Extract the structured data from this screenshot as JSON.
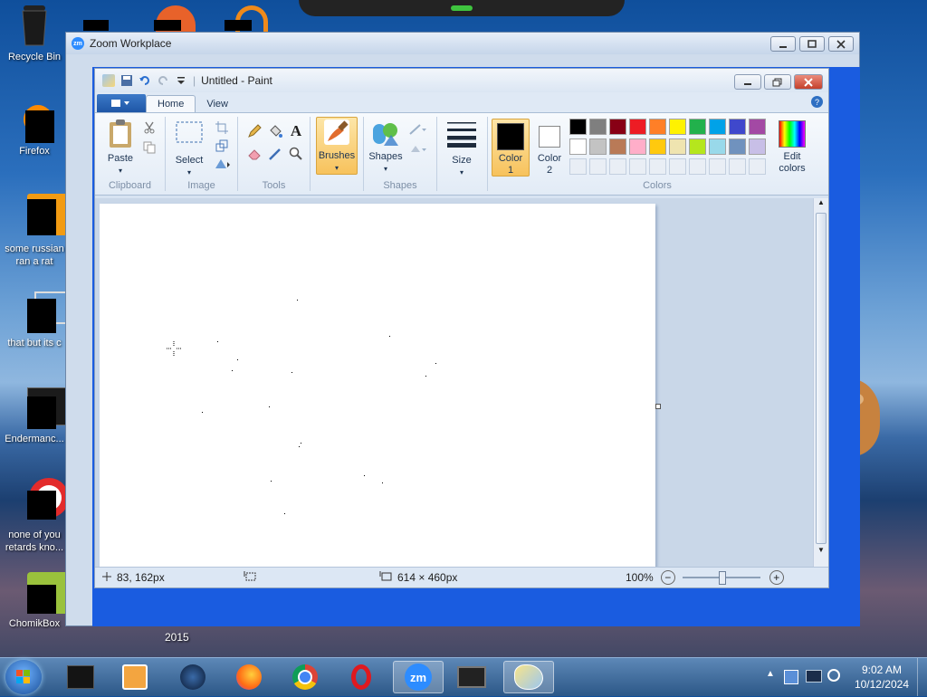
{
  "desktop": {
    "icons": [
      {
        "label": "Recycle Bin"
      },
      {
        "label": "Firefox"
      },
      {
        "label": "some russian ran a rat"
      },
      {
        "label": "that but its c"
      },
      {
        "label": "Endermanc..."
      },
      {
        "label": "none of you retards kno..."
      },
      {
        "label": "ChomikBox"
      }
    ],
    "stray_text": "2015"
  },
  "zoom": {
    "title": "Zoom Workplace",
    "logo": "zm"
  },
  "paint": {
    "title": "Untitled - Paint",
    "tabs": [
      "Home",
      "View"
    ],
    "ribbon": {
      "paste": "Paste",
      "select": "Select",
      "brushes": "Brushes",
      "shapes": "Shapes",
      "size": "Size",
      "color1": "Color 1",
      "color2": "Color 2",
      "edit_colors": "Edit colors",
      "groups": [
        "Clipboard",
        "Image",
        "Tools",
        "Shapes",
        "Colors"
      ]
    },
    "palette_row1": [
      "#000000",
      "#7f7f7f",
      "#880015",
      "#ed1c24",
      "#ff7f27",
      "#fff200",
      "#22b14c",
      "#00a2e8",
      "#3f48cc",
      "#a349a4"
    ],
    "palette_row2": [
      "#ffffff",
      "#c3c3c3",
      "#b97a57",
      "#ffaec9",
      "#ffc90e",
      "#efe4b0",
      "#b5e61d",
      "#99d9ea",
      "#7092be",
      "#c8bfe7"
    ],
    "color1_value": "#000000",
    "color2_value": "#ffffff",
    "status": {
      "cursor": "83, 162px",
      "size": "614 × 460px",
      "zoom": "100%"
    }
  },
  "taskbar": {
    "time": "9:02 AM",
    "date": "10/12/2024",
    "zoom_label": "zm"
  }
}
